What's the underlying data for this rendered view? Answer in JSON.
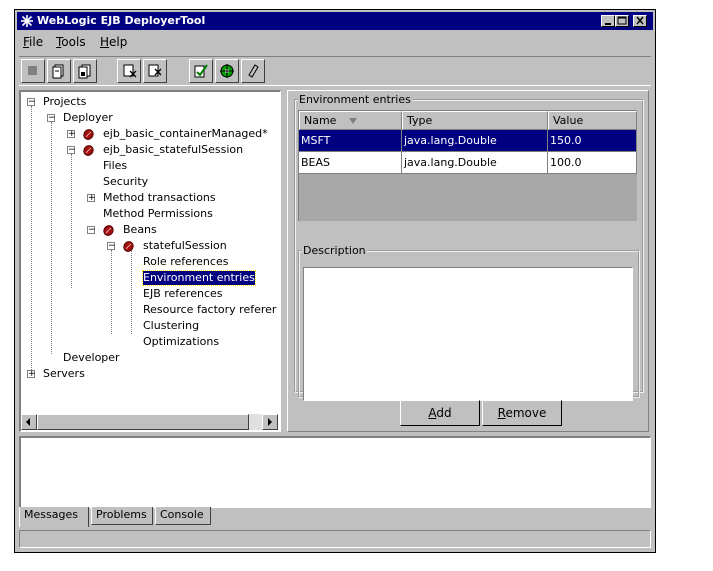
{
  "window": {
    "title": "WebLogic EJB DeployerTool"
  },
  "menu": [
    {
      "label": "File",
      "mnemonic": "F",
      "rest": "ile"
    },
    {
      "label": "Tools",
      "mnemonic": "T",
      "rest": "ools"
    },
    {
      "label": "Help",
      "mnemonic": "H",
      "rest": "elp"
    }
  ],
  "toolbar": [
    "back-icon",
    "open-icon",
    "save-icon",
    "disconnect-icon",
    "connect-icon",
    "validate-icon",
    "deploy-icon",
    "clear-icon"
  ],
  "tree": {
    "projects": "Projects",
    "deployer": "Deployer",
    "container_managed": "ejb_basic_containerManaged*",
    "stateful_session_jar": "ejb_basic_statefulSession",
    "files": "Files",
    "security": "Security",
    "method_transactions": "Method transactions",
    "method_permissions": "Method Permissions",
    "beans": "Beans",
    "stateful_session": "statefulSession",
    "role_references": "Role references",
    "environment_entries": "Environment entries",
    "ejb_references": "EJB references",
    "resource_factory": "Resource factory referer",
    "clustering": "Clustering",
    "optimizations": "Optimizations",
    "developer": "Developer",
    "servers": "Servers"
  },
  "env_panel": {
    "legend": "Environment entries",
    "columns": [
      "Name",
      "Type",
      "Value"
    ],
    "rows": [
      {
        "name": "MSFT",
        "type": "java.lang.Double",
        "value": "150.0",
        "selected": true
      },
      {
        "name": "BEAS",
        "type": "java.lang.Double",
        "value": "100.0",
        "selected": false
      }
    ],
    "description_legend": "Description",
    "add": {
      "mnemonic": "A",
      "rest": "dd"
    },
    "remove": {
      "mnemonic": "R",
      "rest": "emove"
    }
  },
  "tabs": [
    "Messages",
    "Problems",
    "Console"
  ],
  "colors": {
    "titlebar": "#000080",
    "selection": "#000080",
    "face": "#c0c0c0"
  }
}
